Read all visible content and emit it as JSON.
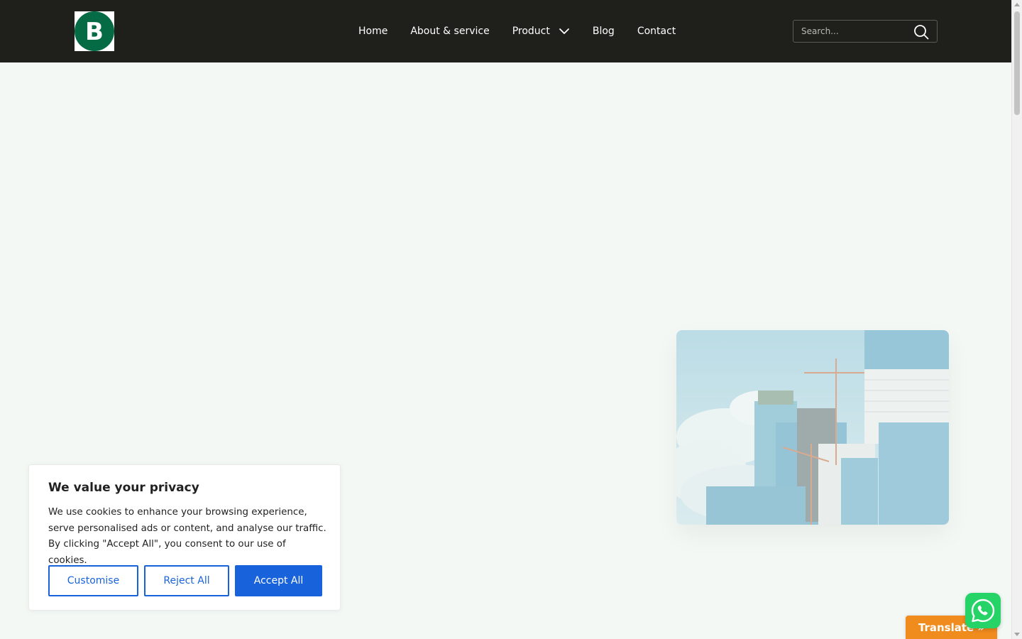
{
  "header": {
    "logo_letter": "B",
    "nav": {
      "home": "Home",
      "about": "About & service",
      "product": "Product",
      "blog": "Blog",
      "contact": "Contact"
    },
    "search": {
      "placeholder": "Search..."
    }
  },
  "cookie": {
    "title": "We value your privacy",
    "text": "We use cookies to enhance your browsing experience, serve personalised ads or content, and analyse our traffic. By clicking \"Accept All\", you consent to our use of cookies.",
    "customise_label": "Customise",
    "reject_label": "Reject All",
    "accept_label": "Accept All"
  },
  "translate": {
    "label": "Translate »"
  },
  "colors": {
    "header_bg": "#1f1f1c",
    "page_bg": "#f3f8f5",
    "logo_green": "#046b45",
    "cookie_blue": "#1863dc",
    "translate_orange": "#f08c1e",
    "whatsapp_green": "#25d366"
  },
  "icons": {
    "search": "search-icon",
    "product_dropdown": "chevron-down-icon",
    "whatsapp": "whatsapp-icon"
  }
}
